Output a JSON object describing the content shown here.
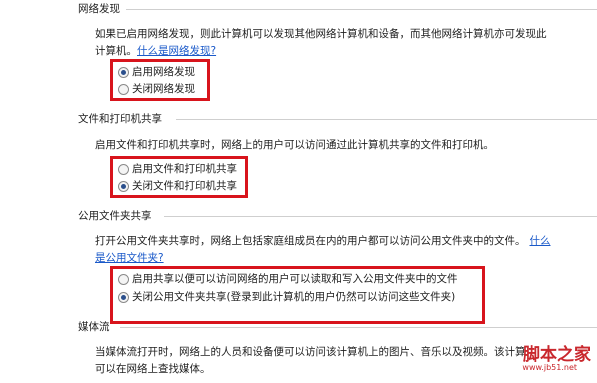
{
  "network_discovery": {
    "title": "网络发现",
    "desc_line1": "如果已启用网络发现，则此计算机可以发现其他网络计算机和设备，而其他网络计算机亦可发现此",
    "desc_line2": "计算机。",
    "help_link": "什么是网络发现?",
    "options": [
      {
        "label": "启用网络发现",
        "checked": true
      },
      {
        "label": "关闭网络发现",
        "checked": false
      }
    ]
  },
  "file_printer_sharing": {
    "title": "文件和打印机共享",
    "desc": "启用文件和打印机共享时，网络上的用户可以访问通过此计算机共享的文件和打印机。",
    "options": [
      {
        "label": "启用文件和打印机共享",
        "checked": false
      },
      {
        "label": "关闭文件和打印机共享",
        "checked": true
      }
    ]
  },
  "public_folder_sharing": {
    "title": "公用文件夹共享",
    "desc_line1": "打开公用文件夹共享时，网络上包括家庭组成员在内的用户都可以访问公用文件夹中的文件。",
    "help_link_part1": "什么",
    "help_link_part2": "是公用文件夹?",
    "options": [
      {
        "label": "启用共享以便可以访问网络的用户可以读取和写入公用文件夹中的文件",
        "checked": false
      },
      {
        "label": "关闭公用文件夹共享(登录到此计算机的用户仍然可以访问这些文件夹)",
        "checked": true
      }
    ]
  },
  "media_streaming": {
    "title": "媒体流",
    "desc_line1": "当媒体流打开时，网络上的人员和设备便可以访问该计算机上的图片、音乐以及视频。该计算",
    "desc_line2": "可以在网络上查找媒体。"
  },
  "watermark": {
    "main": "脚本之家",
    "url": "www.jb51.net"
  }
}
